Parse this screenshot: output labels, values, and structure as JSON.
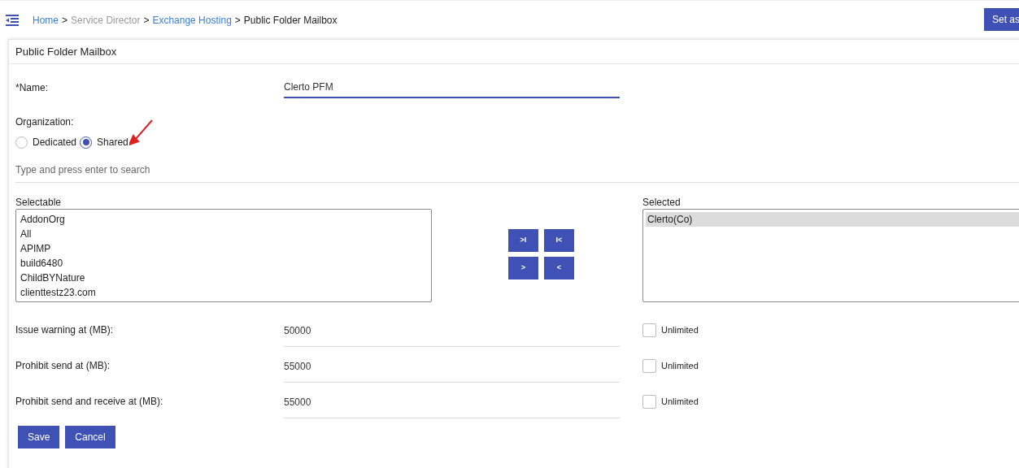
{
  "breadcrumb": [
    {
      "label": "Home",
      "kind": "link"
    },
    {
      "label": "Service Director",
      "kind": "muted"
    },
    {
      "label": "Exchange Hosting",
      "kind": "link"
    },
    {
      "label": "Public Folder Mailbox",
      "kind": "current"
    }
  ],
  "breadcrumb_separator": ">",
  "top_button": "Set as",
  "card": {
    "title": "Public Folder Mailbox"
  },
  "name_field": {
    "label": "*Name:",
    "value": "Clerto PFM"
  },
  "organization": {
    "label": "Organization:",
    "options": [
      {
        "label": "Dedicated",
        "selected": false
      },
      {
        "label": "Shared",
        "selected": true
      }
    ]
  },
  "search": {
    "placeholder": "Type and press enter to search"
  },
  "selectable": {
    "label": "Selectable",
    "items": [
      {
        "label": "AddonOrg",
        "selected": false
      },
      {
        "label": "All",
        "selected": false
      },
      {
        "label": "APIMP",
        "selected": false
      },
      {
        "label": "build6480",
        "selected": false
      },
      {
        "label": "ChildBYNature",
        "selected": false
      },
      {
        "label": "clienttestz23.com",
        "selected": false
      }
    ]
  },
  "transfer_buttons": [
    ">I",
    "I<",
    ">",
    "<"
  ],
  "selected_list": {
    "label": "Selected",
    "items": [
      {
        "label": "Clerto(Co)",
        "selected": true
      }
    ]
  },
  "quotas": [
    {
      "label": "Issue warning at (MB):",
      "value": "50000",
      "unlimited_label": "Unlimited",
      "checked": false
    },
    {
      "label": "Prohibit send at (MB):",
      "value": "55000",
      "unlimited_label": "Unlimited",
      "checked": false
    },
    {
      "label": "Prohibit send and receive at (MB):",
      "value": "55000",
      "unlimited_label": "Unlimited",
      "checked": false
    }
  ],
  "actions": [
    "Save",
    "Cancel"
  ]
}
